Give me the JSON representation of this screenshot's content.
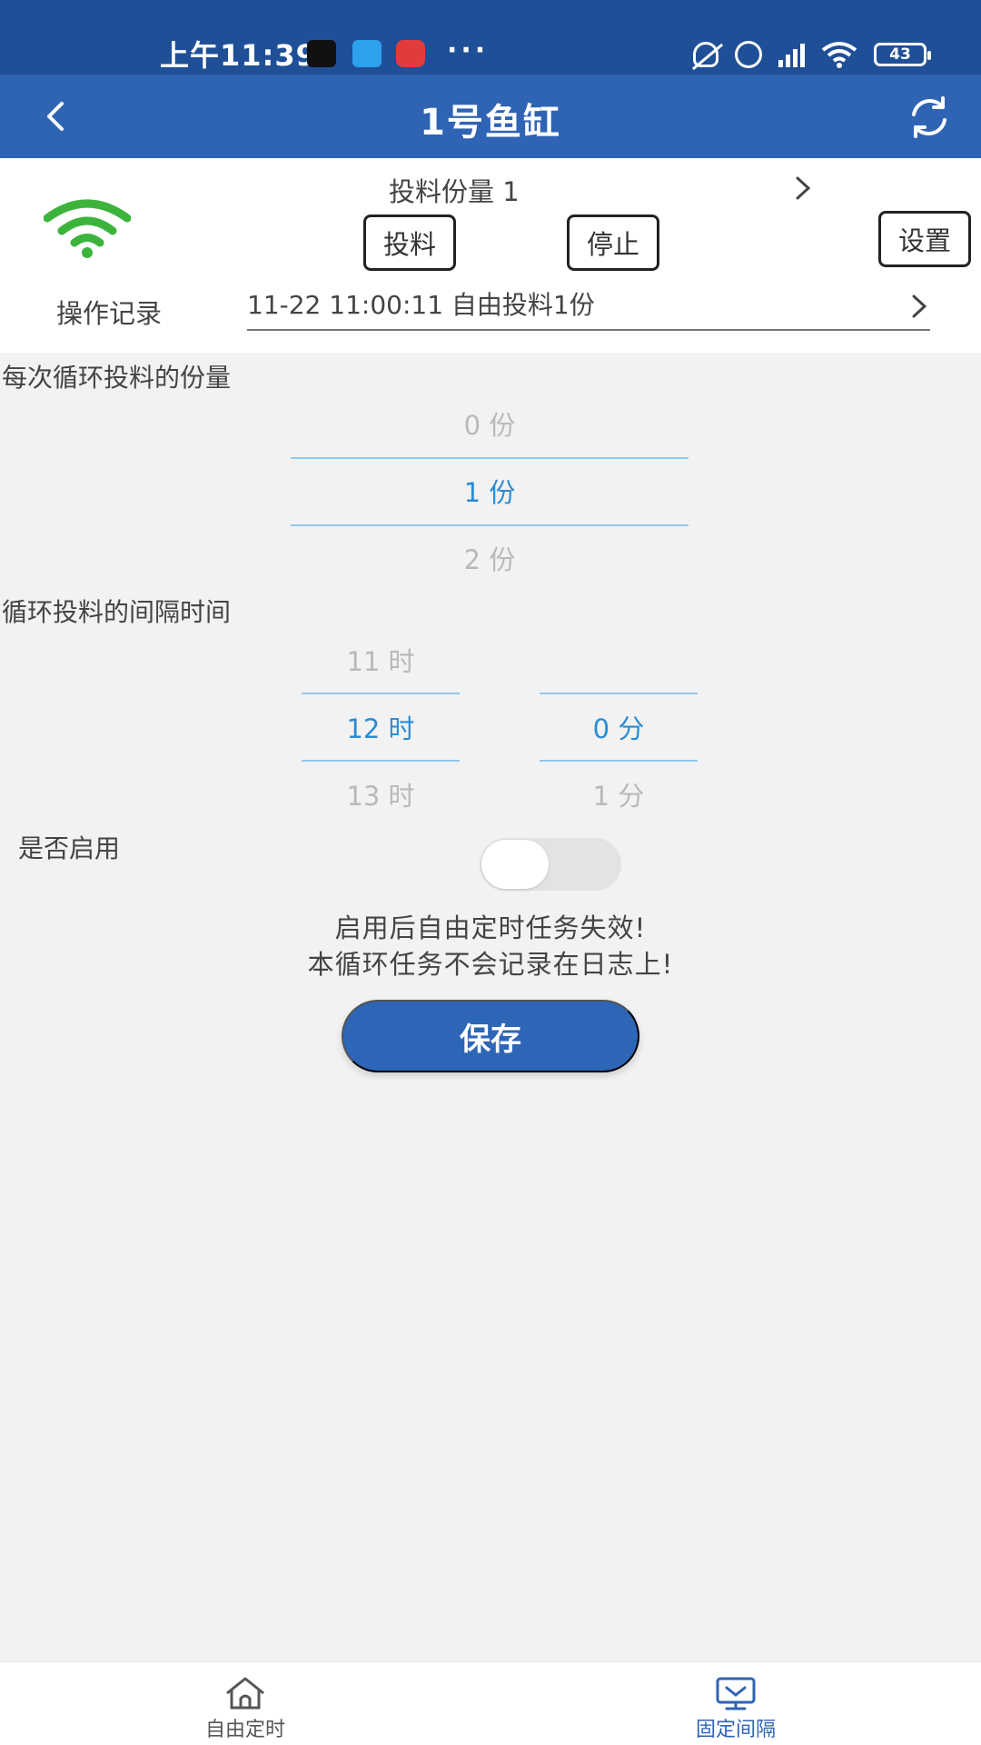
{
  "status_bar": {
    "time": "上午11:39",
    "battery": "43",
    "more": "···"
  },
  "app_bar": {
    "title": "1号鱼缸"
  },
  "device": {
    "portion_label": "投料份量 1",
    "feed_button": "投料",
    "stop_button": "停止",
    "settings_button": "设置",
    "log_label": "操作记录",
    "log_value": "11-22 11:00:11 自由投料1份",
    "wifi_color": "#3cb43c"
  },
  "portion_section": {
    "title": "每次循环投料的份量",
    "wheel": [
      "0 份",
      "1 份",
      "2 份"
    ],
    "selected": "1 份"
  },
  "interval_section": {
    "title": "循环投料的间隔时间",
    "hours": [
      "11 时",
      "12 时",
      "13 时"
    ],
    "minutes": [
      "0 分",
      "1 分"
    ],
    "selected_hour": "12 时",
    "selected_minute": "0 分"
  },
  "enable": {
    "label": "是否启用",
    "enabled": false
  },
  "notices": [
    "启用后自由定时任务失效!",
    "本循环任务不会记录在日志上!"
  ],
  "save_button": "保存",
  "bottom_nav": {
    "items": [
      {
        "label": "自由定时",
        "icon": "home-icon",
        "active": false
      },
      {
        "label": "固定间隔",
        "icon": "monitor-icon",
        "active": true
      }
    ]
  },
  "colors": {
    "primary": "#2f63b4",
    "status_bar": "#1f4f96",
    "picker_selected": "#2a8cd4",
    "picker_line": "#8ec9ec"
  }
}
